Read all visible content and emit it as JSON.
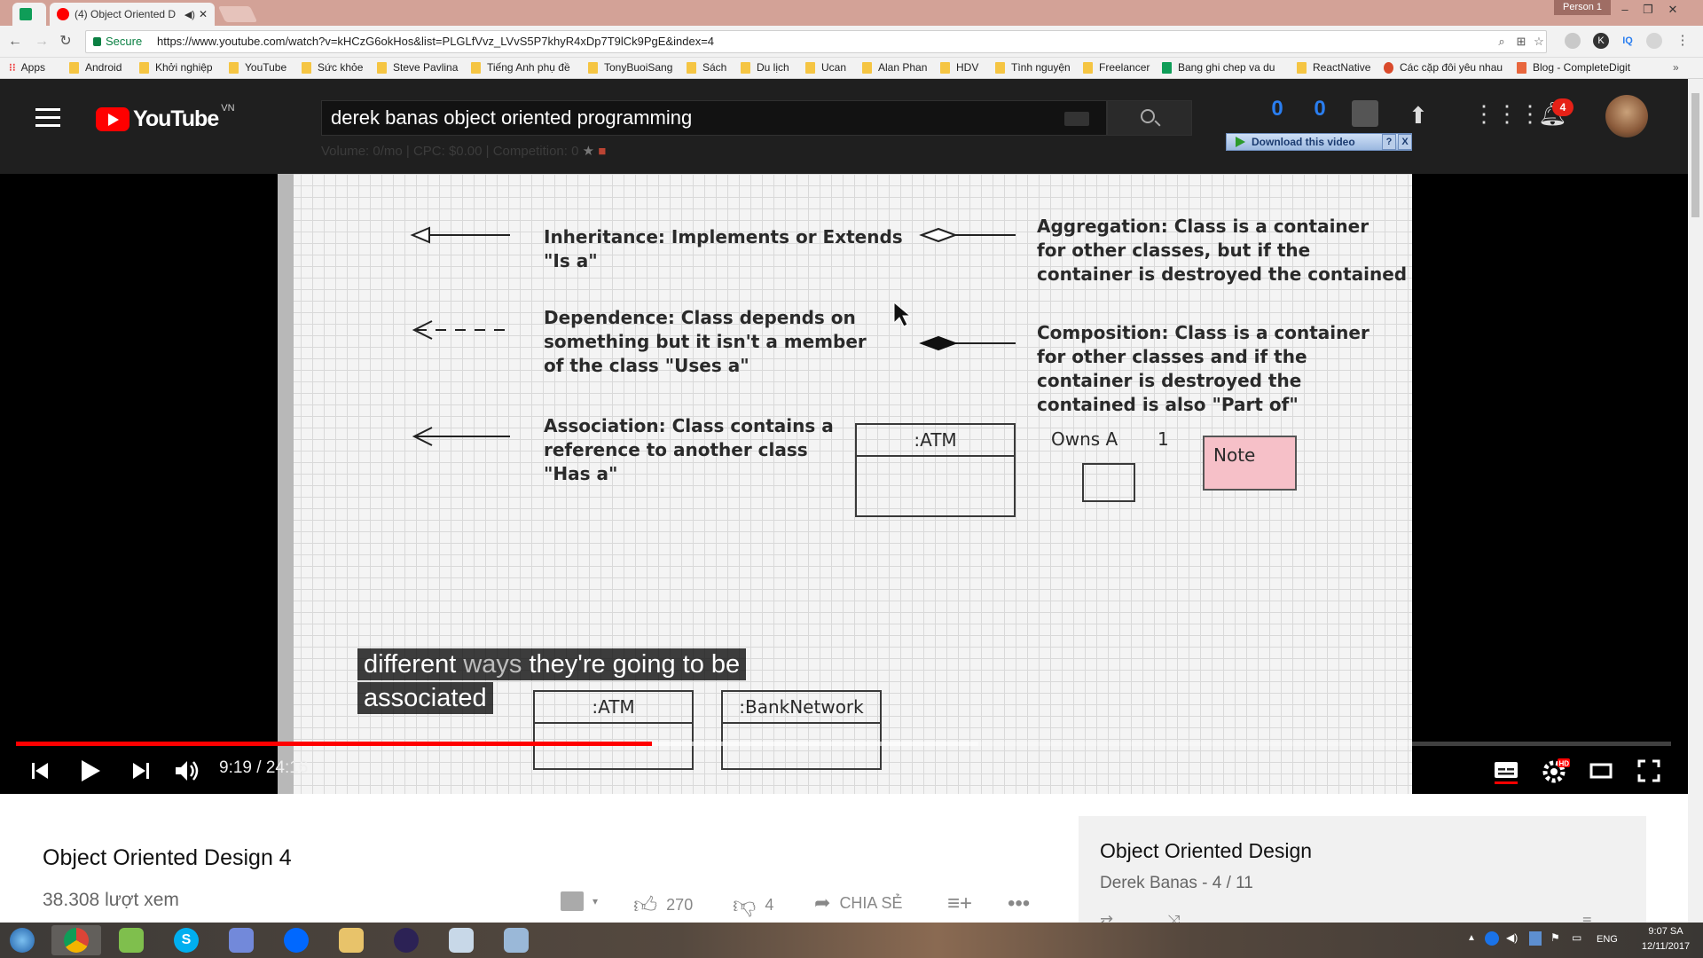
{
  "browser": {
    "tabs": [
      {
        "title": ""
      },
      {
        "title": "(4) Object Oriented D"
      }
    ],
    "profile": "Person 1",
    "secure_label": "Secure",
    "url": "https://www.youtube.com/watch?v=kHCzG6okHos&list=PLGLfVvz_LVvS5P7khyR4xDp7T9lCk9PgE&index=4",
    "bookmarks": [
      "Apps",
      "Android",
      "Khởi nghiệp",
      "YouTube",
      "Sức khỏe",
      "Steve Pavlina",
      "Tiếng Anh phụ đề",
      "TonyBuoiSang",
      "Sách",
      "Du lịch",
      "Ucan",
      "Alan Phan",
      "HDV",
      "Tình nguyện",
      "Freelancer",
      "Bang ghi chep va du",
      "ReactNative",
      "Các cặp đôi yêu nhau",
      "Blog - CompleteDigit"
    ]
  },
  "youtube": {
    "logo_text": "YouTube",
    "country_code": "VN",
    "search_query": "derek banas object oriented programming",
    "seo_stats": "Volume: 0/mo | CPC: $0.00 | Competition: 0",
    "counters": [
      "0",
      "0"
    ],
    "notification_count": "4",
    "download_button": "Download this video",
    "download_help": "?",
    "download_close": "X"
  },
  "video": {
    "slide": {
      "inheritance": [
        "Inheritance: Implements or Extends",
        "\"Is a\""
      ],
      "dependence": [
        "Dependence: Class depends on",
        "something but it isn't a member",
        "of the class \"Uses a\""
      ],
      "association": [
        "Association: Class contains a",
        "reference to another class",
        "\"Has a\""
      ],
      "aggregation": [
        "Aggregation: Class is a container",
        "for other classes, but if the",
        "container is destroyed the contained"
      ],
      "composition": [
        "Composition: Class is a container",
        "for other classes and if the",
        "container is destroyed the",
        "contained is also \"Part of\""
      ],
      "atm_box": ":ATM",
      "owns_label": "Owns A",
      "multiplicity": "1",
      "note_label": "Note",
      "atm_box_2": ":ATM",
      "bank_box": ":BankNetwork"
    },
    "captions": {
      "line1": "different ways they're going to be",
      "line1_bright_a": "different",
      "line1_dim": "ways",
      "line1_bright_b": "they're going to be",
      "line2": "associated"
    },
    "time_current": "9:19",
    "time_total": "24:16",
    "time_display": "9:19 / 24:16",
    "progress_fraction": 0.384
  },
  "info": {
    "title": "Object Oriented Design 4",
    "views": "38.308 lượt xem",
    "likes": "270",
    "dislikes": "4",
    "share_label": "CHIA SẺ"
  },
  "playlist": {
    "title": "Object Oriented Design",
    "subtitle": "Derek Banas - 4 / 11"
  },
  "taskbar": {
    "language": "ENG",
    "time": "9:07 SA",
    "date": "12/11/2017"
  },
  "colors": {
    "accent_red": "#ff0000",
    "header_bg": "#1f1f1f",
    "counter_blue": "#2a7ef0"
  }
}
